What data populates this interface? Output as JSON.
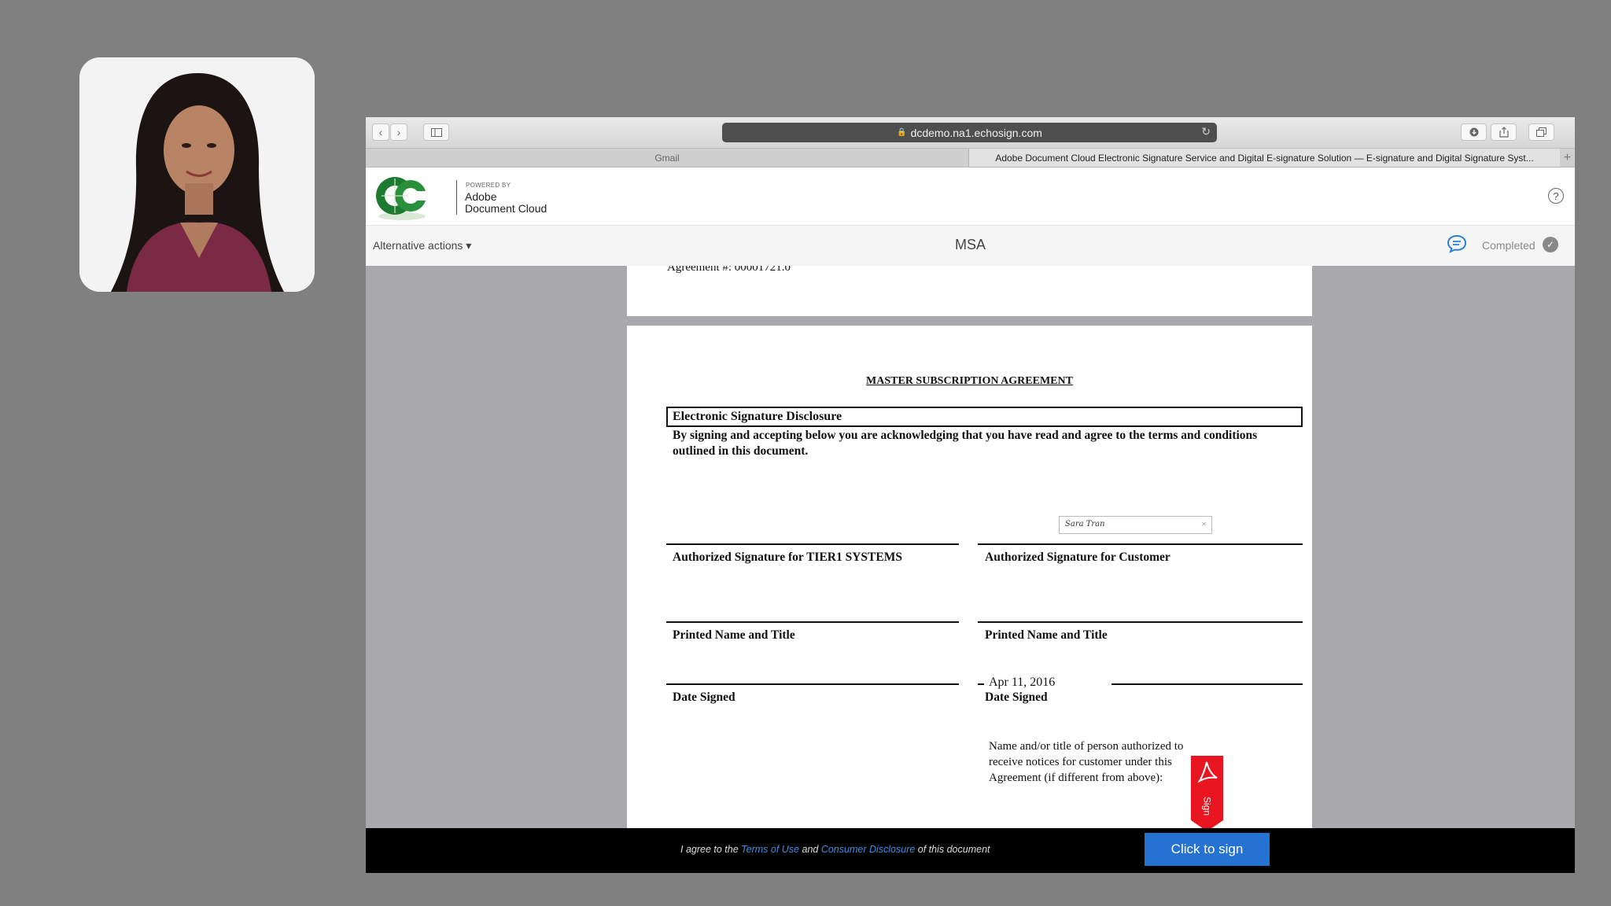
{
  "browser": {
    "url": "dcdemo.na1.echosign.com",
    "tabs": [
      {
        "label": "Gmail"
      },
      {
        "label": "Adobe Document Cloud Electronic Signature Service and Digital E-signature Solution — E-signature and Digital Signature Syst..."
      }
    ],
    "new_tab": "+"
  },
  "header": {
    "powered_by": "POWERED BY",
    "brand_line1": "Adobe",
    "brand_line2": "Document Cloud",
    "help": "?"
  },
  "actionbar": {
    "alternative_actions": "Alternative actions ▾",
    "title": "MSA",
    "status": "Completed"
  },
  "document": {
    "agreement_number": "Agreement #: 00001721.0",
    "title": "MASTER SUBSCRIPTION AGREEMENT",
    "disclosure_title": "Electronic Signature Disclosure",
    "disclosure_text": "By signing and accepting below you are acknowledging that you have read and agree to the terms and conditions outlined in this document.",
    "signature_scribble": "Sara Tran",
    "sig_label_left": "Authorized Signature for TIER1 SYSTEMS",
    "sig_label_right": "Authorized Signature for Customer",
    "name_label_left": "Printed Name and Title",
    "name_label_right": "Printed Name and Title",
    "date_value": "Apr 11, 2016",
    "date_label_left": "Date Signed",
    "date_label_right": "Date Signed",
    "notice_text": "Name and/or title of person authorized to receive notices for customer under this Agreement (if different from above):"
  },
  "sign_flag": {
    "label": "Sign"
  },
  "footer": {
    "agree_prefix": "I agree to the ",
    "terms_link": "Terms of Use",
    "and": " and ",
    "disclosure_link": "Consumer Disclosure",
    "agree_suffix": " of this document",
    "sign_button": "Click to sign"
  },
  "colors": {
    "accent": "#2473d3",
    "sign_flag": "#e8141f",
    "footer_bg": "#000000"
  }
}
